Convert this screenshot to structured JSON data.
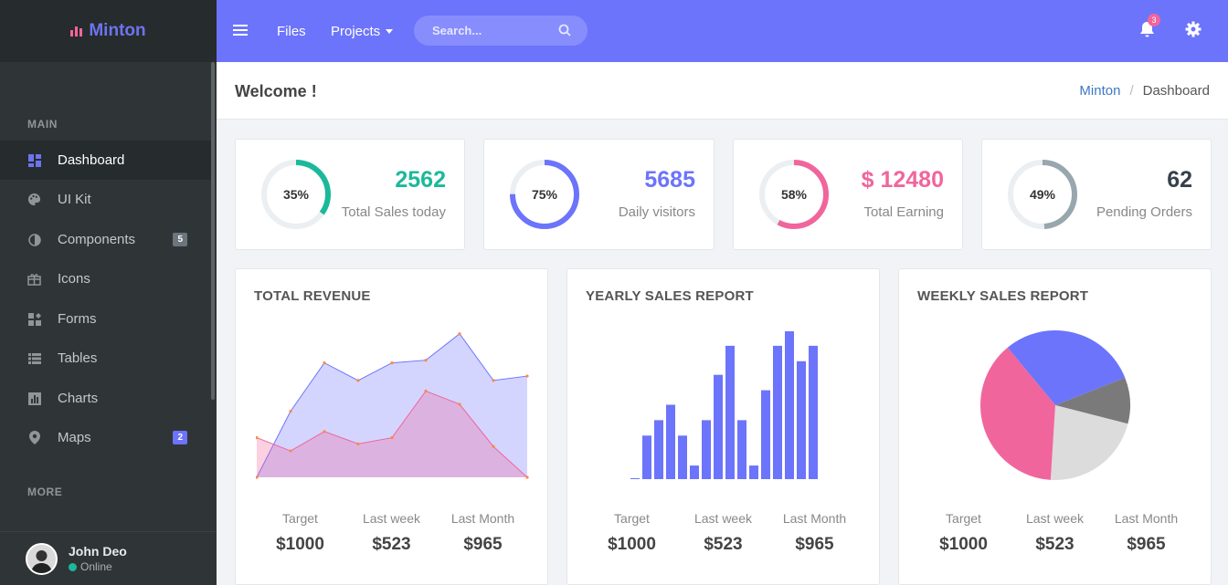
{
  "brand": {
    "name": "Minton"
  },
  "sidebar": {
    "sections": [
      {
        "title": "MAIN"
      },
      {
        "title": "MORE"
      }
    ],
    "items": [
      {
        "label": "Dashboard",
        "icon": "dashboard-icon",
        "active": true
      },
      {
        "label": "UI Kit",
        "icon": "palette-icon"
      },
      {
        "label": "Components",
        "icon": "half-circle-icon",
        "badge": "5",
        "badge_color": "#6c757d"
      },
      {
        "label": "Icons",
        "icon": "gift-icon"
      },
      {
        "label": "Forms",
        "icon": "forms-icon"
      },
      {
        "label": "Tables",
        "icon": "list-icon"
      },
      {
        "label": "Charts",
        "icon": "chart-icon"
      },
      {
        "label": "Maps",
        "icon": "map-pin-icon",
        "badge": "2",
        "badge_color": "#6c74fb"
      }
    ],
    "user": {
      "name": "John Deo",
      "status": "Online"
    }
  },
  "topbar": {
    "links": [
      {
        "label": "Files"
      },
      {
        "label": "Projects"
      }
    ],
    "search": {
      "placeholder": "Search..."
    },
    "notifications": {
      "count": "3"
    }
  },
  "page": {
    "title": "Welcome !",
    "breadcrumb": [
      "Minton",
      "Dashboard"
    ]
  },
  "stats": [
    {
      "percent": 35,
      "percent_label": "35%",
      "value": "2562",
      "label": "Total Sales today",
      "color": "#1bb99a"
    },
    {
      "percent": 75,
      "percent_label": "75%",
      "value": "5685",
      "label": "Daily visitors",
      "color": "#6c74fb"
    },
    {
      "percent": 58,
      "percent_label": "58%",
      "value": "$ 12480",
      "label": "Total Earning",
      "color": "#f1659d"
    },
    {
      "percent": 49,
      "percent_label": "49%",
      "value": "62",
      "label": "Pending Orders",
      "color": "#98a6ad",
      "value_color": "#36404a"
    }
  ],
  "charts": [
    {
      "title": "TOTAL REVENUE",
      "footer": [
        {
          "label": "Target",
          "value": "$1000"
        },
        {
          "label": "Last week",
          "value": "$523"
        },
        {
          "label": "Last Month",
          "value": "$965"
        }
      ]
    },
    {
      "title": "YEARLY SALES REPORT",
      "footer": [
        {
          "label": "Target",
          "value": "$1000"
        },
        {
          "label": "Last week",
          "value": "$523"
        },
        {
          "label": "Last Month",
          "value": "$965"
        }
      ]
    },
    {
      "title": "WEEKLY SALES REPORT",
      "footer": [
        {
          "label": "Target",
          "value": "$1000"
        },
        {
          "label": "Last week",
          "value": "$523"
        },
        {
          "label": "Last Month",
          "value": "$965"
        }
      ]
    }
  ],
  "chart_data": [
    {
      "type": "area",
      "series": [
        {
          "values": [
            0,
            75,
            130,
            110,
            130,
            133,
            163,
            110,
            115
          ],
          "color": "#6c74fb"
        },
        {
          "values": [
            45,
            30,
            52,
            38,
            45,
            98,
            83,
            35,
            0
          ],
          "color": "#f1659d"
        }
      ],
      "ylim": [
        0,
        170
      ],
      "grid": false
    },
    {
      "type": "bar",
      "values": [
        0,
        48,
        65,
        82,
        48,
        15,
        65,
        115,
        147,
        65,
        15,
        98,
        147,
        163,
        130,
        147
      ],
      "color": "#6c74fb",
      "ylim": [
        0,
        165
      ],
      "grid": false
    },
    {
      "type": "pie",
      "values": [
        30,
        10,
        22,
        38
      ],
      "colors": [
        "#6c74fb",
        "#7a7a7a",
        "#dcdcdc",
        "#f1659d"
      ]
    }
  ]
}
